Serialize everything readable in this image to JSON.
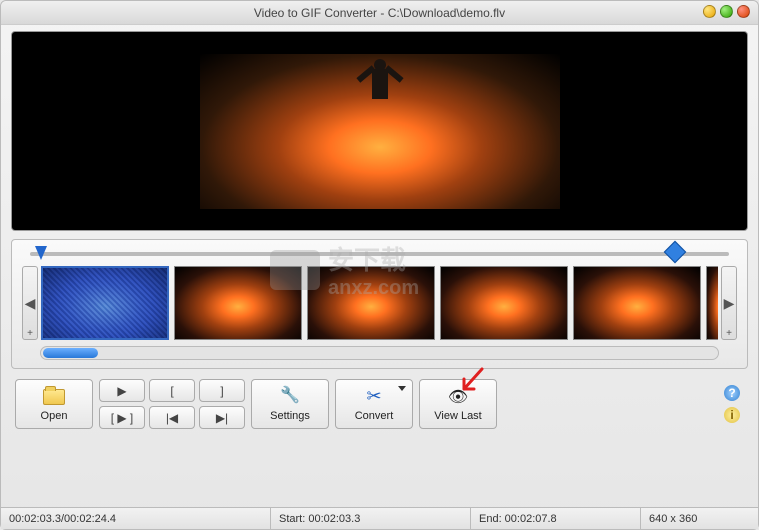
{
  "window": {
    "title": "Video to GIF Converter - C:\\Download\\demo.flv"
  },
  "toolbar": {
    "open_label": "Open",
    "settings_label": "Settings",
    "convert_label": "Convert",
    "viewlast_label": "View Last",
    "play_glyph": "▶",
    "mark_in_glyph": "[",
    "mark_out_glyph": "]",
    "range_glyph": "[ ▶ ]",
    "prev_frame_glyph": "|◀",
    "next_frame_glyph": "▶|"
  },
  "thumbs": {
    "prev_glyph": "◀",
    "next_glyph": "▶",
    "add_glyph": "+"
  },
  "status": {
    "time": "00:02:03.3/00:02:24.4",
    "start": "Start: 00:02:03.3",
    "end": "End: 00:02:07.8",
    "dims": "640 x 360"
  },
  "watermark": {
    "text": "anxz.com",
    "cn": "安下载"
  }
}
